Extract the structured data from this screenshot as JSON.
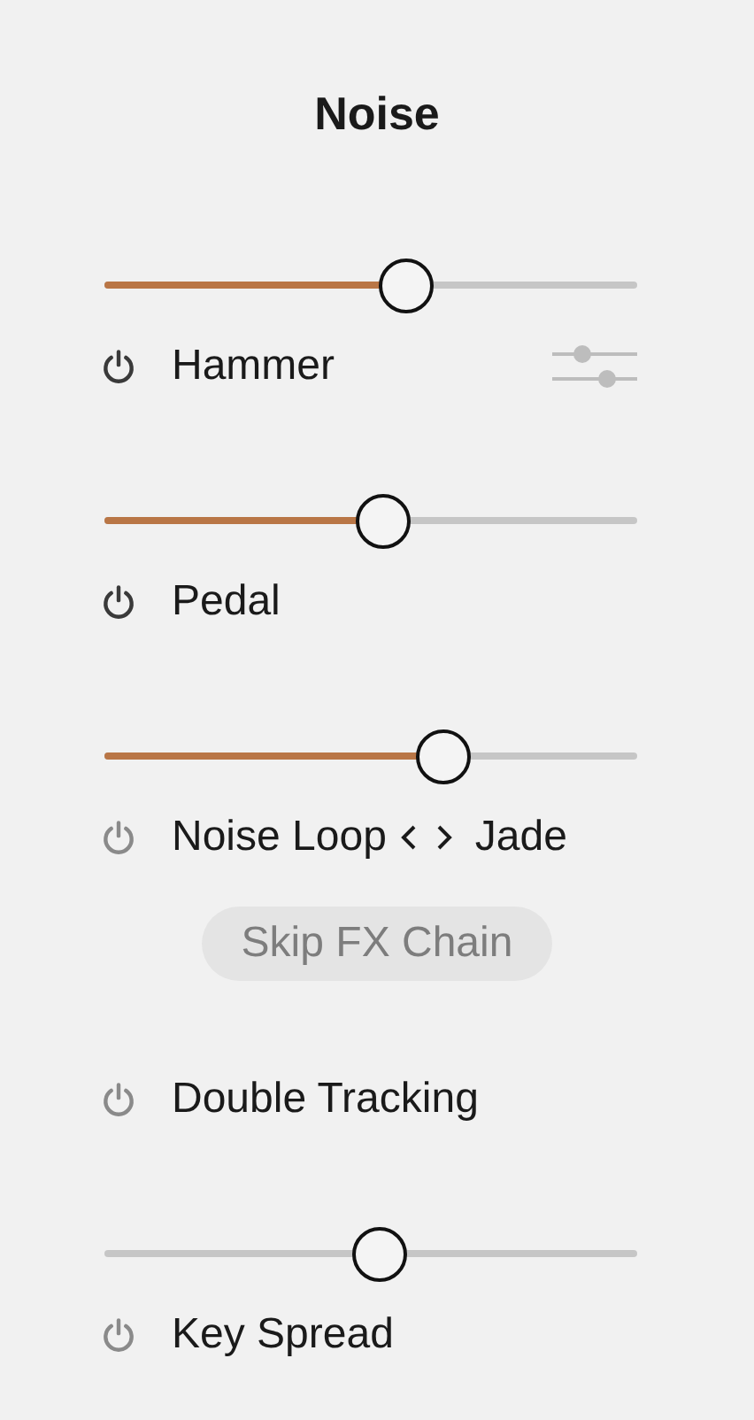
{
  "title": "Noise",
  "items": [
    {
      "name": "Hammer",
      "on": true,
      "settings": true,
      "slider": {
        "kind": "filled",
        "level": 0.565
      }
    },
    {
      "name": "Pedal",
      "on": true,
      "slider": {
        "kind": "filled",
        "level": 0.52
      }
    },
    {
      "name": "Noise Loop",
      "on": false,
      "slider": {
        "kind": "filled",
        "level": 0.635
      },
      "preset": "Jade",
      "action": {
        "label": "Skip FX Chain",
        "disabled": true
      }
    },
    {
      "name": "Double Tracking",
      "on": false
    },
    {
      "name": "Key Spread",
      "on": false,
      "slider": {
        "kind": "plain",
        "level": 0.515
      }
    }
  ]
}
